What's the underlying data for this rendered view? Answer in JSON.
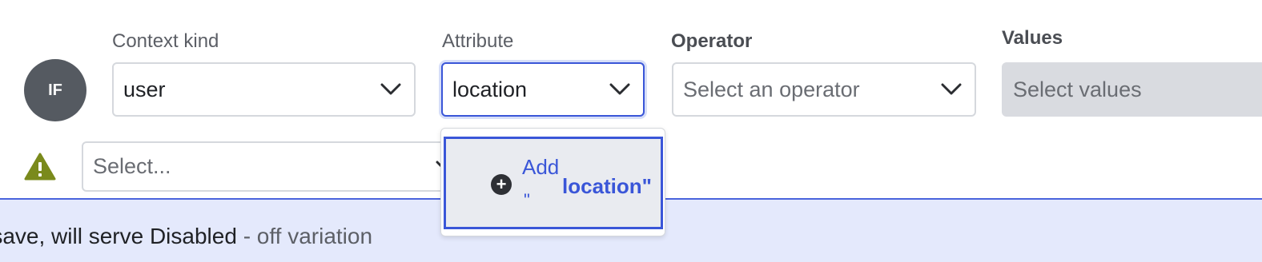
{
  "clause": {
    "badge": "IF",
    "context_kind": {
      "label": "Context kind",
      "value": "user"
    },
    "attribute": {
      "label": "Attribute",
      "value": "location"
    },
    "operator": {
      "label": "Operator",
      "placeholder": "Select an operator"
    },
    "values": {
      "label": "Values",
      "placeholder": "Select values"
    }
  },
  "warning_row": {
    "icon": "warning-icon",
    "select_placeholder": "Select..."
  },
  "dropdown": {
    "option": {
      "prefix": "Add",
      "quote": "\"",
      "value": "location\"",
      "icon": "plus-circle-icon"
    }
  },
  "banner": {
    "text": "n save, will serve Disabled",
    "muted": " - off variation"
  },
  "colors": {
    "accent": "#3a56d8",
    "badge": "#555a61",
    "warning": "#7a8a1c",
    "banner_bg": "#e4e9fc"
  }
}
